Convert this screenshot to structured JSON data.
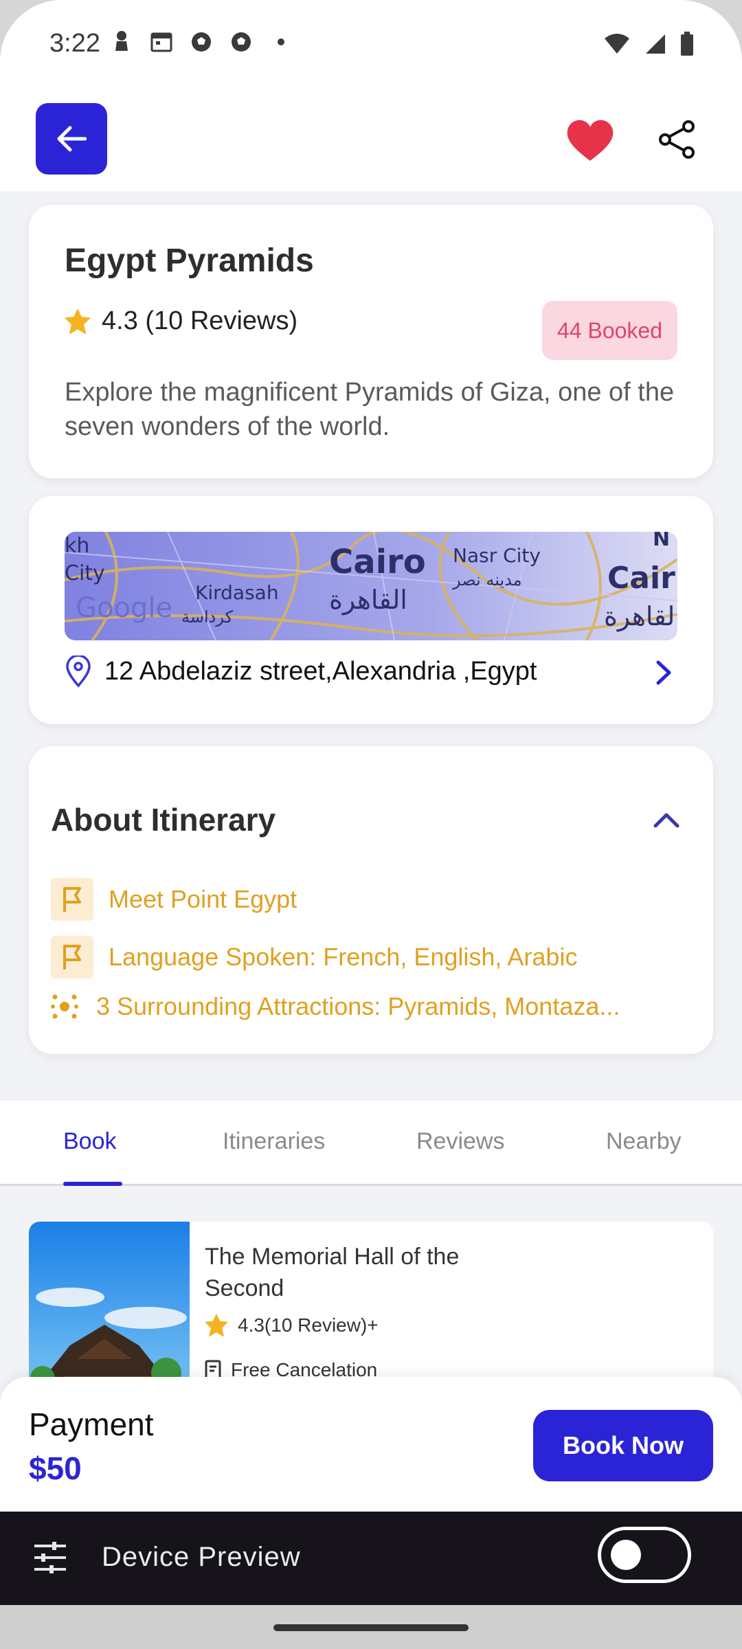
{
  "status_bar": {
    "time": "3:22",
    "left_icons": [
      "pawn-icon",
      "calendar-icon",
      "soccer-ball-icon",
      "soccer-ball-icon",
      "dot-icon"
    ],
    "right_icons": [
      "wifi-icon",
      "signal-icon",
      "battery-icon"
    ]
  },
  "header": {
    "back_icon": "arrow-left-icon",
    "favorite_icon": "heart-icon",
    "share_icon": "share-icon",
    "accent_color": "#2b24d6",
    "heart_color": "#e5334a"
  },
  "tour": {
    "title": "Egypt Pyramids",
    "rating": "4.3 (10 Reviews)",
    "booked": "44 Booked",
    "description": "Explore the magnificent Pyramids of Giza, one of the seven wonders of the world."
  },
  "location": {
    "map_labels": {
      "cairo": "Cairo",
      "cairo_ar": "القاهرة",
      "nasr_city": "Nasr City",
      "nasr_city_ar": "مدينه نصر",
      "kirdasah": "Kirdasah",
      "kirdasah_ar": "كرداسة",
      "google": "Google"
    },
    "address": "12 Abdelaziz street,Alexandria ,Egypt"
  },
  "itinerary": {
    "title": "About Itinerary",
    "items": [
      {
        "icon": "flag-icon",
        "text": "Meet Point Egypt"
      },
      {
        "icon": "flag-icon",
        "text": "Language Spoken: French, English, Arabic"
      },
      {
        "icon": "attractions-icon",
        "text": "3 Surrounding Attractions: Pyramids, Montaza..."
      }
    ]
  },
  "tabs": [
    {
      "label": "Book",
      "active": true
    },
    {
      "label": "Itineraries",
      "active": false
    },
    {
      "label": "Reviews",
      "active": false
    },
    {
      "label": "Nearby",
      "active": false
    }
  ],
  "book_item": {
    "name": "The Memorial Hall of the Second",
    "rating": "4.3(10 Review)+",
    "cancelation": "Free Cancelation"
  },
  "payment": {
    "label": "Payment",
    "amount": "$50",
    "button": "Book Now"
  },
  "device_preview": {
    "label": "Device Preview",
    "toggle_on": false
  }
}
